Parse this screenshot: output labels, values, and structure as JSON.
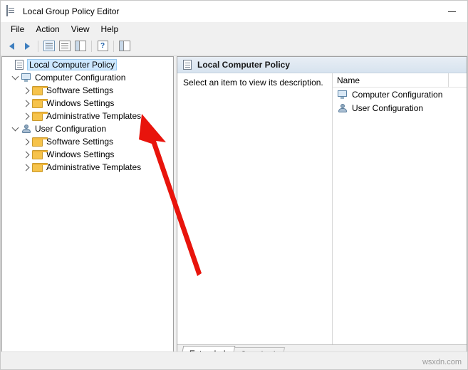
{
  "window": {
    "title": "Local Group Policy Editor",
    "icon": "policy-document-icon",
    "minimize_label": "–"
  },
  "menu": {
    "items": [
      {
        "label": "File"
      },
      {
        "label": "Action"
      },
      {
        "label": "View"
      },
      {
        "label": "Help"
      }
    ]
  },
  "toolbar": {
    "buttons": [
      {
        "name": "back-button",
        "icon": "arrow-left-icon"
      },
      {
        "name": "forward-button",
        "icon": "arrow-right-icon"
      },
      {
        "name": "show-hide-console-tree-button",
        "icon": "console-tree-icon"
      },
      {
        "name": "properties-button",
        "icon": "properties-icon"
      },
      {
        "name": "refresh-button",
        "icon": "refresh-icon"
      },
      {
        "name": "help-button",
        "icon": "help-icon",
        "glyph": "?"
      },
      {
        "name": "show-hide-action-pane-button",
        "icon": "action-pane-icon"
      }
    ]
  },
  "tree": {
    "root": {
      "label": "Local Computer Policy",
      "icon": "policy-document-icon",
      "selected": true
    },
    "nodes": [
      {
        "label": "Computer Configuration",
        "icon": "computer-icon",
        "state": "expanded",
        "level": 1,
        "children": [
          {
            "label": "Software Settings",
            "icon": "folder-icon",
            "state": "collapsed",
            "level": 2
          },
          {
            "label": "Windows Settings",
            "icon": "folder-icon",
            "state": "collapsed",
            "level": 2
          },
          {
            "label": "Administrative Templates",
            "icon": "folder-icon",
            "state": "collapsed",
            "level": 2
          }
        ]
      },
      {
        "label": "User Configuration",
        "icon": "user-icon",
        "state": "expanded",
        "level": 1,
        "children": [
          {
            "label": "Software Settings",
            "icon": "folder-icon",
            "state": "collapsed",
            "level": 2
          },
          {
            "label": "Windows Settings",
            "icon": "folder-icon",
            "state": "collapsed",
            "level": 2
          },
          {
            "label": "Administrative Templates",
            "icon": "folder-icon",
            "state": "collapsed",
            "level": 2
          }
        ]
      }
    ]
  },
  "right_pane": {
    "header": "Local Computer Policy",
    "header_icon": "policy-document-icon",
    "description": "Select an item to view its description.",
    "list": {
      "column_header": "Name",
      "items": [
        {
          "label": "Computer Configuration",
          "icon": "computer-icon"
        },
        {
          "label": "User Configuration",
          "icon": "user-icon"
        }
      ]
    },
    "tabs": [
      {
        "label": "Extended",
        "active": true
      },
      {
        "label": "Standard",
        "active": false
      }
    ]
  },
  "annotation": {
    "arrow_color": "#e8140c",
    "description": "red-arrow-pointing-to-administrative-templates"
  },
  "status": {
    "watermark": "wsxdn.com"
  }
}
